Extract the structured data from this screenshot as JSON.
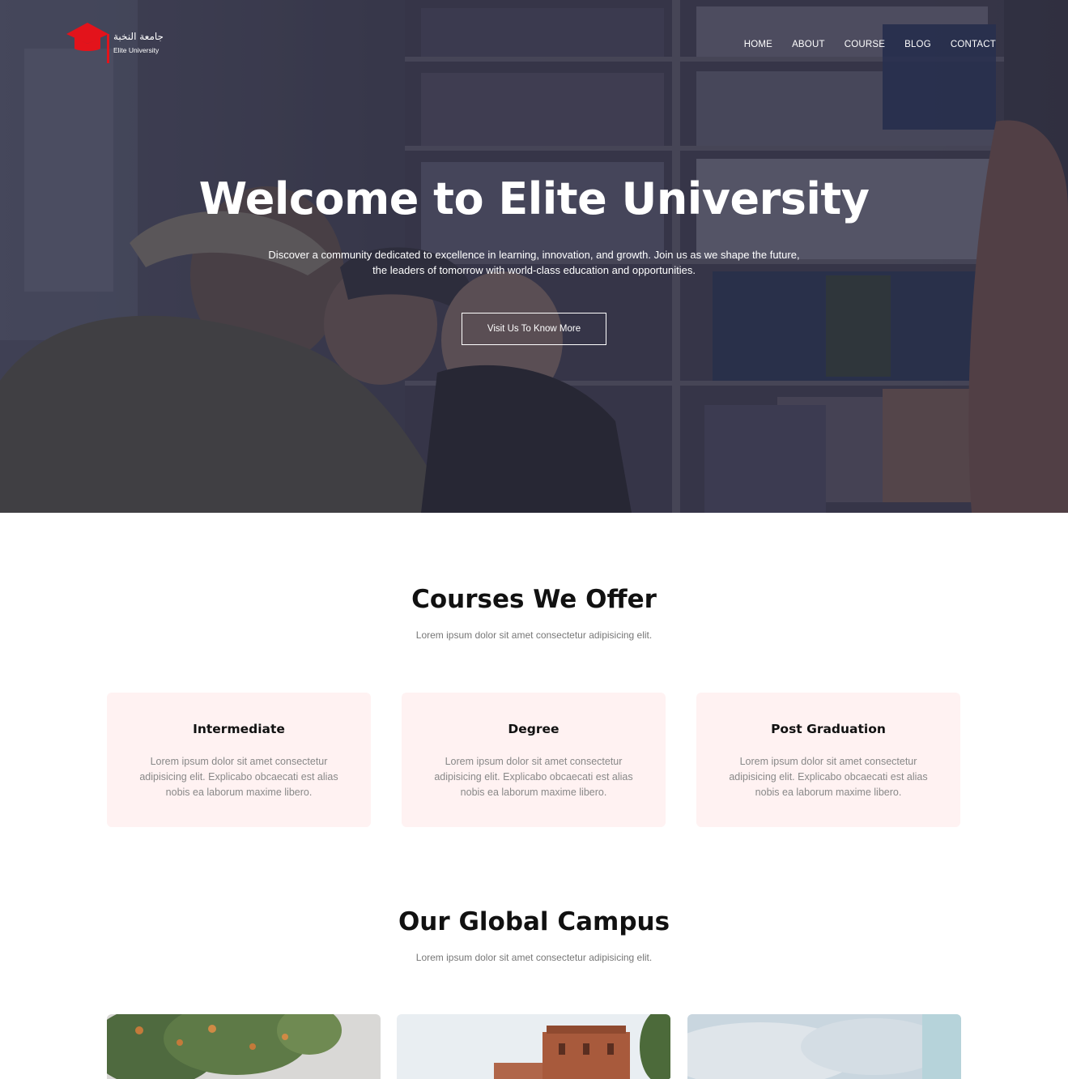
{
  "brand": {
    "name_arabic": "جامعة النخبة",
    "name_english": "Elite University",
    "logo_color": "#e3131b"
  },
  "nav": {
    "items": [
      "HOME",
      "ABOUT",
      "COURSE",
      "BLOG",
      "CONTACT"
    ]
  },
  "hero": {
    "title": "Welcome to Elite University",
    "description_line1": "Discover a community dedicated to excellence in learning, innovation, and growth. Join us as we shape the future,",
    "description_line2": "the leaders of tomorrow with world-class education and opportunities.",
    "button_label": "Visit Us To Know More"
  },
  "courses": {
    "title": "Courses We Offer",
    "subtitle": "Lorem ipsum dolor sit amet consectetur adipisicing elit.",
    "cards": [
      {
        "title": "Intermediate",
        "text": "Lorem ipsum dolor sit amet consectetur adipisicing elit. Explicabo obcaecati est alias nobis ea laborum maxime libero."
      },
      {
        "title": "Degree",
        "text": "Lorem ipsum dolor sit amet consectetur adipisicing elit. Explicabo obcaecati est alias nobis ea laborum maxime libero."
      },
      {
        "title": "Post Graduation",
        "text": "Lorem ipsum dolor sit amet consectetur adipisicing elit. Explicabo obcaecati est alias nobis ea laborum maxime libero."
      }
    ],
    "card_background": "#fff2f2"
  },
  "campus": {
    "title": "Our Global Campus",
    "subtitle": "Lorem ipsum dolor sit amet consectetur adipisicing elit."
  }
}
